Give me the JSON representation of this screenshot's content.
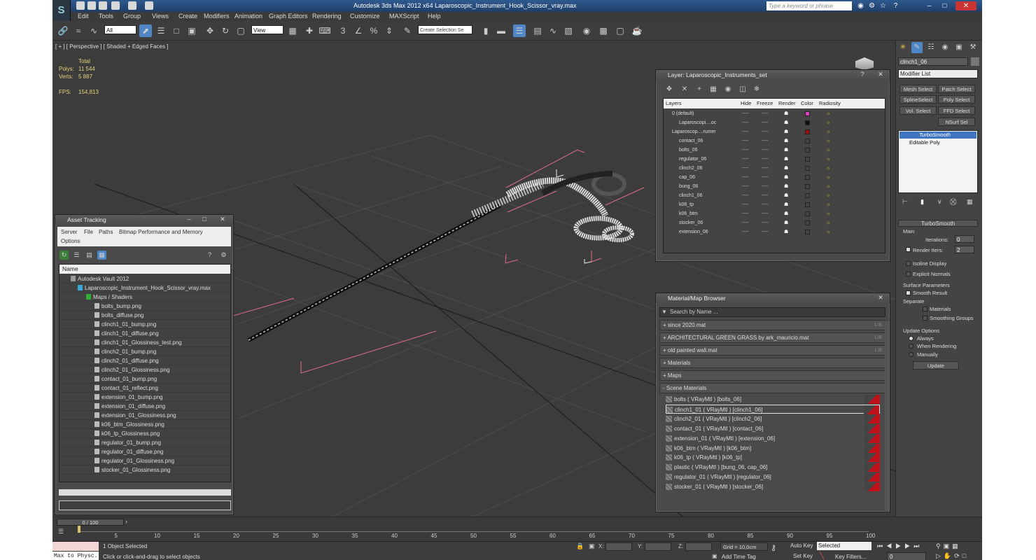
{
  "app": {
    "title": "Autodesk 3ds Max  2012 x64      Laparoscopic_Instrument_Hook_Scissor_vray.max",
    "search_placeholder": "Type a keyword or phrase"
  },
  "menu": [
    "Edit",
    "Tools",
    "Group",
    "Views",
    "Create",
    "Modifiers",
    "Animation",
    "Graph Editors",
    "Rendering",
    "Customize",
    "MAXScript",
    "Help"
  ],
  "toolbar": {
    "selection_filter": "All",
    "reference_coord": "View",
    "named_selection_placeholder": "Create Selection Se"
  },
  "viewport": {
    "label": "[ + ] [ Perspective ] [ Shaded + Edged Faces ]",
    "stats_header": "Total",
    "polys_label": "Polys:",
    "polys_value": "11 544",
    "verts_label": "Verts:",
    "verts_value": "5 887",
    "fps_label": "FPS:",
    "fps_value": "154,813"
  },
  "asset_tracking": {
    "title": "Asset Tracking",
    "menu": [
      "Server",
      "File",
      "Paths",
      "Bitmap Performance and Memory"
    ],
    "menu2": "Options",
    "column": "Name",
    "vault": "Autodesk Vault 2012",
    "file": "Laparoscopic_Instrument_Hook_Scissor_vray.max",
    "group": "Maps / Shaders",
    "maps": [
      "bolts_bump.png",
      "bolts_diffuse.png",
      "clinch1_01_bump.png",
      "clinch1_01_diffuse.png",
      "clinch1_01_Glossiness_test.png",
      "clinch2_01_bump.png",
      "clinch2_01_diffuse.png",
      "clinch2_01_Glossiness.png",
      "contact_01_bump.png",
      "contact_01_reflect.png",
      "extension_01_bump.png",
      "extension_01_diffuse.png",
      "extension_01_Glossiness.png",
      "k06_btm_Glossiness.png",
      "k06_tp_Glossiness.png",
      "regulator_01_bump.png",
      "regulator_01_diffuse.png",
      "regulator_01_Glossiness.png",
      "stocker_01_Glossiness.png"
    ]
  },
  "layers": {
    "title": "Layer: Laparoscopic_Instruments_set",
    "columns": [
      "Layers",
      "Hide",
      "Freeze",
      "Render",
      "Color",
      "Radiosity"
    ],
    "rows": [
      {
        "name": "0 (default)",
        "indent": 0,
        "color": "#e040c0"
      },
      {
        "name": "Laparoscopi....oc",
        "indent": 1,
        "color": "#111111"
      },
      {
        "name": "Laparoscop....rumer",
        "indent": 0,
        "color": "#a01010"
      },
      {
        "name": "contact_06",
        "indent": 1,
        "color": ""
      },
      {
        "name": "bolts_06",
        "indent": 1,
        "color": ""
      },
      {
        "name": "regulator_06",
        "indent": 1,
        "color": ""
      },
      {
        "name": "clinch2_06",
        "indent": 1,
        "color": ""
      },
      {
        "name": "cap_06",
        "indent": 1,
        "color": ""
      },
      {
        "name": "bung_06",
        "indent": 1,
        "color": ""
      },
      {
        "name": "clinch1_06",
        "indent": 1,
        "color": ""
      },
      {
        "name": "k06_tp",
        "indent": 1,
        "color": ""
      },
      {
        "name": "k06_btm",
        "indent": 1,
        "color": ""
      },
      {
        "name": "stocker_06",
        "indent": 1,
        "color": ""
      },
      {
        "name": "extension_06",
        "indent": 1,
        "color": ""
      }
    ],
    "dots": "----"
  },
  "material_browser": {
    "title": "Material/Map Browser",
    "search_placeholder": "Search by Name ...",
    "lib_tag": "LIB",
    "groups": [
      {
        "label": "+ since 2020.mat",
        "lib": true
      },
      {
        "label": "+ ARCHITECTURAL GREEN GRASS by ark_mauricio.mat",
        "lib": true
      },
      {
        "label": "+ old painted wall.mat",
        "lib": true
      },
      {
        "label": "+ Materials",
        "lib": false
      },
      {
        "label": "+ Maps",
        "lib": false
      },
      {
        "label": "- Scene Materials",
        "lib": false
      }
    ],
    "materials": [
      "bolts  ( VRayMtl )  [bolts_06]",
      "clinch1_01  ( VRayMtl )  [clinch1_06]",
      "clinch2_01  ( VRayMtl )  [clinch2_06]",
      "contact_01  ( VRayMtl )  [contact_06]",
      "extension_01  ( VRayMtl )  [extension_06]",
      "k06_btm  ( VRayMtl )  [k06_btm]",
      "k06_tp  ( VRayMtl )  [k06_tp]",
      "plastic  ( VRayMtl )  [bung_06, cap_06]",
      "regulator_01  ( VRayMtl )  [regulator_06]",
      "stocker_01  ( VRayMtl )  [stocker_06]"
    ]
  },
  "command_panel": {
    "object_name": "clinch1_06",
    "modifier_list": "Modifier List",
    "buttons": [
      "Mesh Select",
      "Patch Select",
      "SplineSelect",
      "Poly Select",
      "Vol. Select",
      "FFD Select",
      "NSurf Sel"
    ],
    "stack": [
      "TurboSmooth",
      "Editable Poly"
    ],
    "rollout_title": "TurboSmooth",
    "main": "Main",
    "iterations_label": "Iterations:",
    "iterations_value": "0",
    "render_iters_label": "Render Iters:",
    "render_iters_value": "2",
    "isoline": "Isoline Display",
    "explicit": "Explicit Normals",
    "surface_params": "Surface Parameters",
    "smooth_result": "Smooth Result",
    "separate": "Separate",
    "materials": "Materials",
    "smoothing_groups": "Smoothing Groups",
    "update_options": "Update Options",
    "always": "Always",
    "when_rendering": "When Rendering",
    "manually": "Manually",
    "update": "Update"
  },
  "timeline": {
    "frame": "0 / 100",
    "ticks": [
      "5",
      "10",
      "15",
      "20",
      "25",
      "30",
      "35",
      "40",
      "45",
      "50",
      "55",
      "60",
      "65",
      "70",
      "75",
      "80",
      "85",
      "90",
      "95",
      "100"
    ]
  },
  "status": {
    "maxscript": "Max to Physc.",
    "selected": "1 Object Selected",
    "prompt": "Click or click-and-drag to select objects",
    "x": "X:",
    "y": "Y:",
    "z": "Z:",
    "grid": "Grid = 10,0cm",
    "add_time_tag": "Add Time Tag",
    "auto_key": "Auto Key",
    "set_key": "Set Key",
    "selected_combo": "Selected",
    "key_filters": "Key Filters...",
    "frame_value": "0"
  }
}
